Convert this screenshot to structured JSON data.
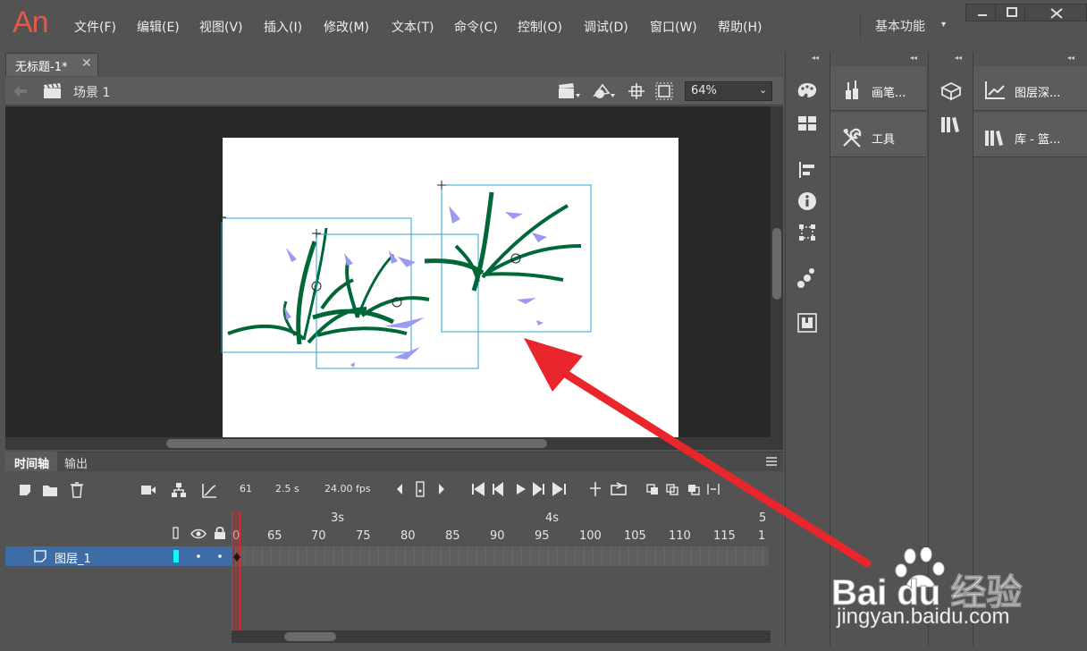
{
  "app": {
    "logo": "An"
  },
  "menu": [
    "文件(F)",
    "编辑(E)",
    "视图(V)",
    "插入(I)",
    "修改(M)",
    "文本(T)",
    "命令(C)",
    "控制(O)",
    "调试(D)",
    "窗口(W)",
    "帮助(H)"
  ],
  "workspace": {
    "label": "基本功能",
    "arrow": "▾"
  },
  "document_tab": {
    "title": "无标题-1*",
    "close": "✕"
  },
  "scene": {
    "label": "场景 1"
  },
  "zoom": {
    "value": "64%",
    "arrow": "⌄"
  },
  "timeline": {
    "tabs": [
      "时间轴",
      "输出"
    ],
    "frame": "61",
    "seconds": "2.5 s",
    "fps": "24.00 fps",
    "time_markers": [
      "3s",
      "4s",
      "5"
    ],
    "frame_numbers": [
      "0",
      "65",
      "70",
      "75",
      "80",
      "85",
      "90",
      "95",
      "100",
      "105",
      "110",
      "115",
      "1"
    ],
    "layer_name": "图层_1"
  },
  "panels": {
    "brush": "画笔...",
    "tools": "工具",
    "layer_depth": "图层深...",
    "library": "库 - 篮..."
  },
  "watermark": {
    "brand": "Bai du 经验",
    "url": "jingyan.baidu.com"
  },
  "colors": {
    "accent": "#3e6ca6",
    "logo": "#e3584a",
    "selection": "#29a3d6",
    "grass": "#006838",
    "flower": "#9b99f1",
    "arrow": "#e8262b"
  }
}
